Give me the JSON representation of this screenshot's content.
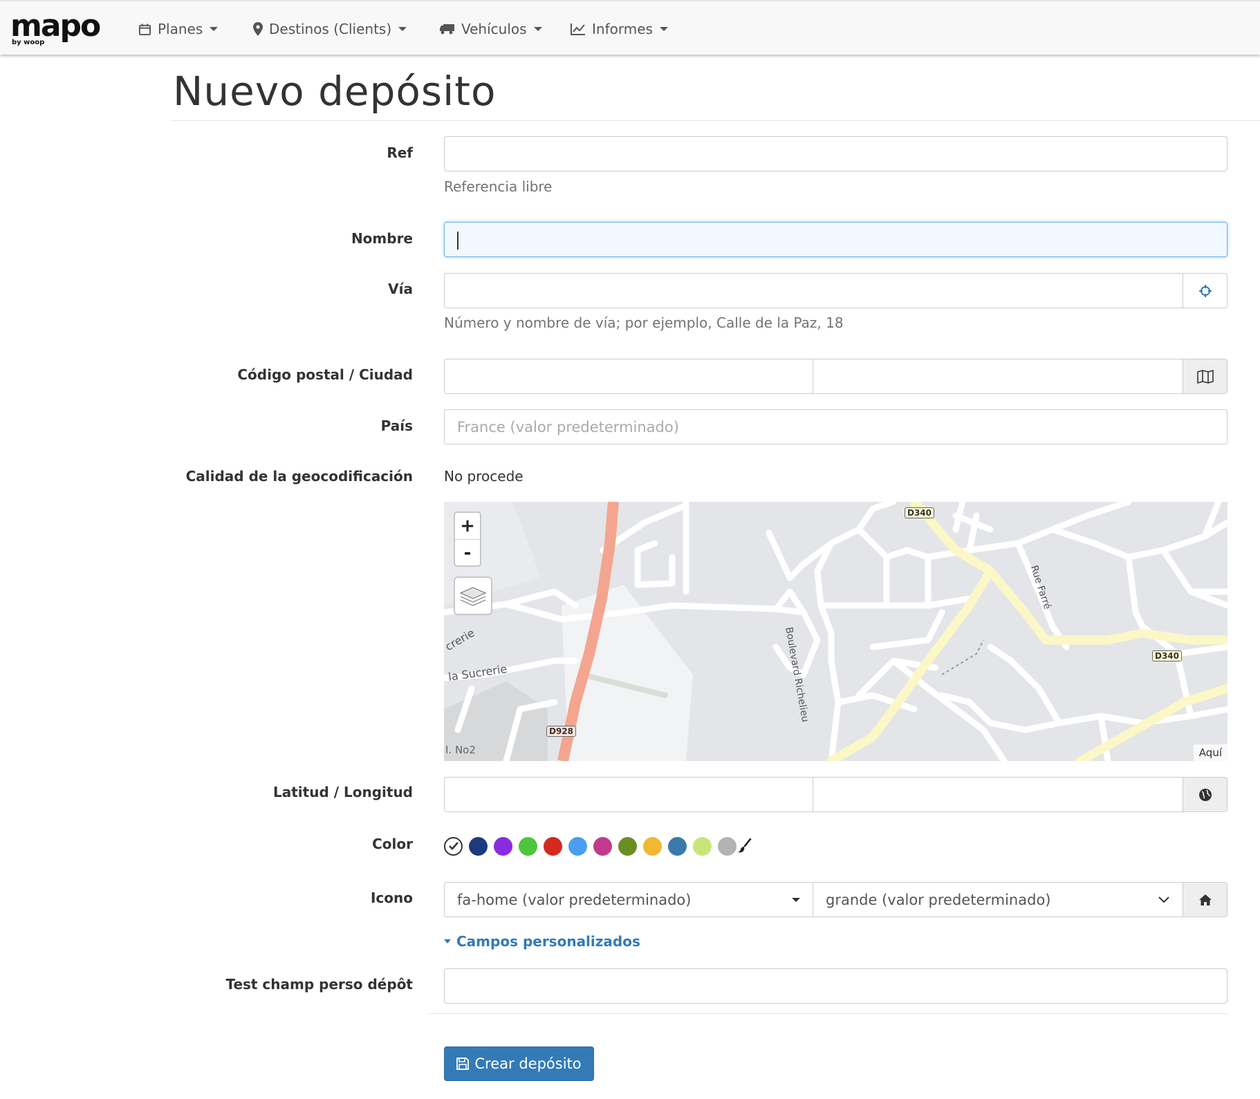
{
  "nav": {
    "logo": "mapo",
    "logo_sub": "by woop",
    "items": [
      {
        "label": "Planes",
        "icon": "calendar-icon"
      },
      {
        "label": "Destinos (Clients)",
        "icon": "map-marker-icon"
      },
      {
        "label": "Vehículos",
        "icon": "truck-icon"
      },
      {
        "label": "Informes",
        "icon": "line-chart-icon"
      }
    ]
  },
  "page": {
    "title": "Nuevo depósito"
  },
  "form": {
    "ref": {
      "label": "Ref",
      "value": "",
      "help": "Referencia libre"
    },
    "name": {
      "label": "Nombre",
      "value": ""
    },
    "street": {
      "label": "Vía",
      "value": "",
      "help": "Número y nombre de vía; por ejemplo, Calle de la Paz, 18"
    },
    "postcode_city": {
      "label": "Código postal / Ciudad",
      "postcode": "",
      "city": ""
    },
    "country": {
      "label": "País",
      "placeholder": "France (valor predeterminado)"
    },
    "geocoding": {
      "label": "Calidad de la geocodificación",
      "value": "No procede"
    },
    "map": {
      "zoom_in": "+",
      "zoom_out": "-",
      "attribution": "Aquí",
      "street_labels": [
        "D340",
        "D340",
        "D928",
        "Rue Farré",
        "Boulevard Richelieu",
        "la Sucrerie",
        "crerie",
        "I. No2"
      ]
    },
    "latlng": {
      "label": "Latitud / Longitud",
      "lat": "",
      "lng": ""
    },
    "color": {
      "label": "Color",
      "options": [
        "#1c3a7e",
        "#8a2be2",
        "#4cc63c",
        "#d4291f",
        "#4a9ef0",
        "#c23a8e",
        "#6b8e23",
        "#f2b733",
        "#3a7aaa",
        "#c9e57a",
        "#b3b3b3"
      ]
    },
    "icon": {
      "label": "Icono",
      "icon_value": "fa-home (valor predeterminado)",
      "size_value": "grande (valor predeterminado)"
    },
    "custom_fields": {
      "toggle_label": "Campos personalizados"
    },
    "test_field": {
      "label": "Test champ perso dépôt",
      "value": ""
    },
    "submit": {
      "label": "Crear depósito"
    }
  }
}
